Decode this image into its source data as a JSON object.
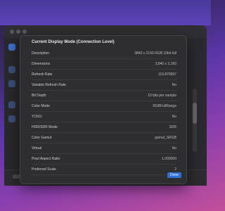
{
  "colors": {
    "panel_bg": "#2e2e31",
    "accent": "#2f6fd6"
  },
  "background_window": {
    "sidebar_icons": [
      "display-icon",
      "app-icon",
      "accessibility-icon",
      "appearance-icon",
      "privacy-icon"
    ]
  },
  "dialog": {
    "title": "Current Display Mode (Connection Level)",
    "rows": [
      {
        "label": "Description",
        "value": "3840 x 2160 RGB 10bit full"
      },
      {
        "label": "Dimensions",
        "value": "3,840 x 2,160"
      },
      {
        "label": "Refresh Rate",
        "value": "119.879997"
      },
      {
        "label": "Variable Refresh Rate",
        "value": "No"
      },
      {
        "label": "Bit Depth",
        "value": "10 bits per sample"
      },
      {
        "label": "Color Mode",
        "value": "RGBFullRange"
      },
      {
        "label": "YCbCr",
        "value": "No"
      },
      {
        "label": "HDR/SDR Mode",
        "value": "SDR"
      },
      {
        "label": "Color Gamut",
        "value": "gamut_SRGB"
      },
      {
        "label": "Virtual",
        "value": "No"
      },
      {
        "label": "Pixel Aspect Ratio",
        "value": "1.000000"
      },
      {
        "label": "Preferred Scale",
        "value": "2"
      }
    ],
    "done_label": "Done"
  }
}
